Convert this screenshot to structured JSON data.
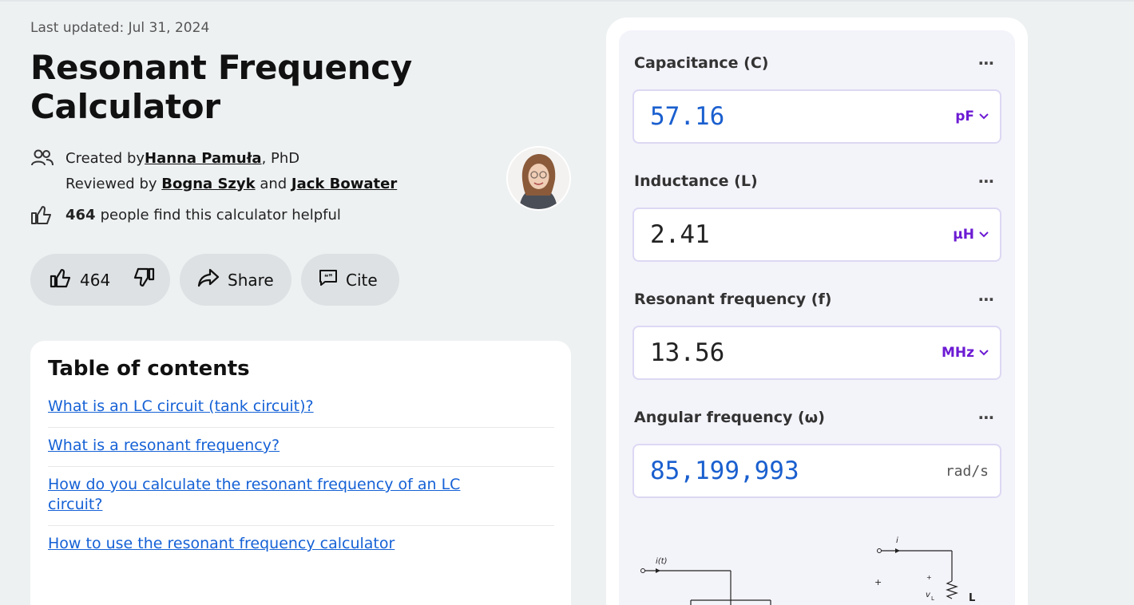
{
  "meta": {
    "last_updated": "Last updated: Jul 31, 2024"
  },
  "page": {
    "title": "Resonant Frequency Calculator"
  },
  "authors": {
    "created_prefix": "Created by ",
    "creator": "Hanna Pamuła",
    "creator_suffix": ", PhD",
    "reviewed_prefix": "Reviewed by ",
    "reviewer1": "Bogna Szyk",
    "and": " and ",
    "reviewer2": "Jack Bowater"
  },
  "helpful": {
    "count": "464",
    "text": "people find this calculator helpful"
  },
  "actions": {
    "upvotes": "464",
    "share_label": "Share",
    "cite_label": "Cite"
  },
  "toc": {
    "heading": "Table of contents",
    "items": [
      {
        "label": "What is an LC circuit (tank circuit)?"
      },
      {
        "label": "What is a resonant frequency?"
      },
      {
        "label": "How do you calculate the resonant frequency of an LC circuit?"
      },
      {
        "label": "How to use the resonant frequency calculator"
      }
    ]
  },
  "calculator": {
    "fields": [
      {
        "label": "Capacitance (C)",
        "value": "57.16",
        "unit": "pF"
      },
      {
        "label": "Inductance (L)",
        "value": "2.41",
        "unit": "µH"
      },
      {
        "label": "Resonant frequency (f)",
        "value": "13.56",
        "unit": "MHz"
      },
      {
        "label": "Angular frequency (ω)",
        "value": "85,199,993",
        "unit": "rad/s"
      }
    ],
    "more_icon": "⋯"
  },
  "diagram": {
    "labels": {
      "it": "i(t)",
      "i": "i",
      "plus": "+",
      "vl": "v",
      "vl_sub": "L",
      "L": "L"
    }
  },
  "colors": {
    "link": "#1561d6",
    "unit": "#6c1bd3",
    "value": "#1a5fcf"
  }
}
